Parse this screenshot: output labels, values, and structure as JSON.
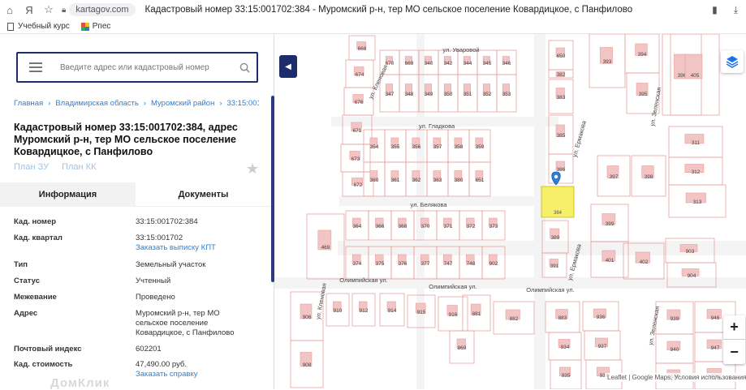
{
  "browser": {
    "domain": "kartagov.com",
    "title": "Кадастровый номер 33:15:001702:384 - Муромский р-н, тер МО сельское поселение Ковардицкое, с Панфилово",
    "bookmarks": [
      {
        "label": "Учебный курс",
        "icon": "page-icon"
      },
      {
        "label": "Рпес",
        "icon": "colorful-icon"
      }
    ]
  },
  "search": {
    "placeholder": "Введите адрес или кадастровый номер"
  },
  "breadcrumbs": [
    "Главная",
    "Владимирская область",
    "Муромский район",
    "33:15:001702"
  ],
  "heading": "Кадастровый номер 33:15:001702:384, адрес Муромский р-н, тер МО сельское поселение Ковардицкое, с Панфилово",
  "plans": {
    "zu": "План ЗУ",
    "kk": "План КК"
  },
  "tabs": {
    "info": "Информация",
    "docs": "Документы"
  },
  "info": {
    "cad_num_label": "Кад. номер",
    "cad_num": "33:15:001702:384",
    "quarter_label": "Кад. квартал",
    "quarter": "33:15:001702",
    "quarter_link": "Заказать выписку КПТ",
    "type_label": "Тип",
    "type": "Земельный участок",
    "status_label": "Статус",
    "status": "Учтенный",
    "survey_label": "Межевание",
    "survey": "Проведено",
    "address_label": "Адрес",
    "address": "Муромский р-н, тер МО сельское поселение Ковардицкое, с Панфилово",
    "postal_label": "Почтовый индекс",
    "postal": "602201",
    "cost_label": "Кад. стоимость",
    "cost": "47,490.00 руб.",
    "cost_link": "Заказать справку"
  },
  "watermark": "ДомКлик",
  "map": {
    "streets": [
      "ул. Уваровой",
      "ул. Гладкова",
      "ул. Белякова",
      "Олимпийская ул.",
      "Олимпийская ул.",
      "Олимпийская ул.",
      "ул. Ермакова",
      "ул. Ермакова",
      "ул. Кленовая",
      "ул. Кленовая",
      "ул. Зеленская",
      "ул. Зеленская"
    ],
    "lots": [
      "668",
      "674",
      "676",
      "671",
      "673",
      "672",
      "670",
      "669",
      "340",
      "342",
      "344",
      "345",
      "346",
      "347",
      "348",
      "349",
      "350",
      "351",
      "352",
      "353",
      "354",
      "355",
      "356",
      "357",
      "358",
      "359",
      "360",
      "361",
      "362",
      "363",
      "380",
      "651",
      "650",
      "382",
      "383",
      "385",
      "386",
      "389",
      "391",
      "393",
      "394",
      "395",
      "396",
      "397",
      "398",
      "399",
      "401",
      "402",
      "405",
      "311",
      "312",
      "313",
      "469",
      "364",
      "366",
      "368",
      "370",
      "371",
      "372",
      "373",
      "374",
      "375",
      "376",
      "377",
      "747",
      "748",
      "902",
      "903",
      "904",
      "906",
      "908",
      "910",
      "912",
      "914",
      "915",
      "916",
      "869",
      "881",
      "882",
      "883",
      "934",
      "935",
      "936",
      "937",
      "938",
      "939",
      "940",
      "945",
      "946",
      "947",
      "948"
    ],
    "highlight_lot": "384",
    "attribution": "Leaflet | Google Maps, Условия использования"
  },
  "colors": {
    "accent": "#1d2d6b",
    "link": "#2e7fd4",
    "highlight": "#f7ee6a",
    "boundary": "#e8a0a0"
  }
}
